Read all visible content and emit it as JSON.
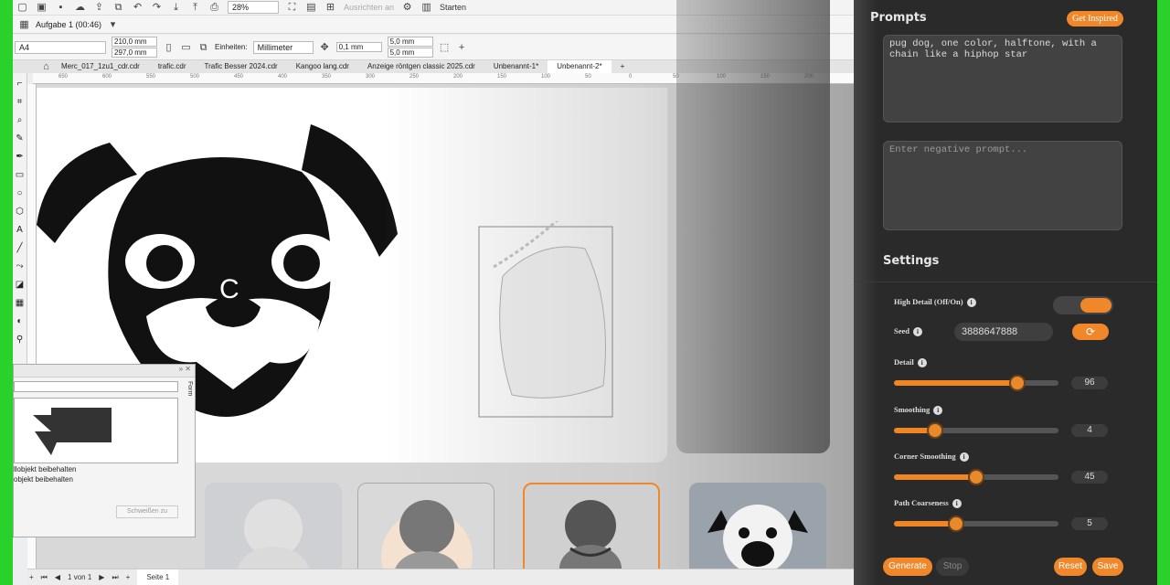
{
  "toolbar": {
    "task_label": "Aufgabe 1 (00:46)",
    "zoom": "28%",
    "snap_label": "Ausrichten an",
    "start_label": "Starten"
  },
  "props": {
    "page_size": "A4",
    "width": "210,0 mm",
    "height": "297,0 mm",
    "units_label": "Einheiten:",
    "units_value": "Millimeter",
    "nudge": "0,1 mm",
    "dup_x": "5,0 mm",
    "dup_y": "5,0 mm"
  },
  "tabs": [
    "Merc_017_1zu1_cdr.cdr",
    "trafic.cdr",
    "Trafic Besser 2024.cdr",
    "Kangoo lang.cdr",
    "Anzeige röntgen classic 2025.cdr",
    "Unbenannt-1*",
    "Unbenannt-2*"
  ],
  "ruler": {
    "ticks": [
      "650",
      "600",
      "550",
      "500",
      "450",
      "400",
      "350",
      "300",
      "250",
      "200",
      "150",
      "100",
      "50",
      "0",
      "50",
      "100",
      "150",
      "200"
    ],
    "unit": "Millimeter"
  },
  "docker": {
    "tab_label": "Form",
    "opt1": "llobjekt beibehalten",
    "opt2": "objekt beibehalten",
    "weld_button": "Schweißen zu"
  },
  "status": {
    "page_info": "1 von 1",
    "page_tab": "Seite 1",
    "vertical_unit": "Millimeter"
  },
  "panel": {
    "prompts_title": "Prompts",
    "inspire_button": "Get Inspired",
    "prompt_text": "pug dog, one color, halftone, with a chain like a hiphop star",
    "negative_placeholder": "Enter negative prompt...",
    "settings_title": "Settings",
    "high_detail_label": "High Detail (Off/On)",
    "seed_label": "Seed",
    "seed_value": "3888647888",
    "sliders": [
      {
        "label": "Detail",
        "value": "96",
        "fraction": 0.75
      },
      {
        "label": "Smoothing",
        "value": "4",
        "fraction": 0.25
      },
      {
        "label": "Corner Smoothing",
        "value": "45",
        "fraction": 0.5
      },
      {
        "label": "Path Coarseness",
        "value": "5",
        "fraction": 0.38
      }
    ],
    "generate_button": "Generate",
    "stop_button": "Stop",
    "reset_button": "Reset",
    "save_button": "Save"
  },
  "colors": {
    "accent": "#f0872a",
    "green_border": "#2bd12b",
    "panel_bg": "#2a2a2a"
  }
}
